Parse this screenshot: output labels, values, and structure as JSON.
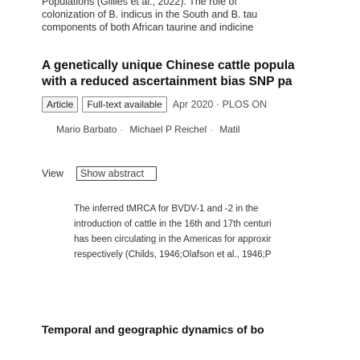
{
  "snippet": {
    "lines": [
      "Populations (Gillies et al., 2022). The role of",
      "colonization of B. indicus in the South and B. tau",
      "components of both African taurine and indicine"
    ]
  },
  "result": {
    "title_line1": "A genetically unique Chinese cattle popula",
    "title_line2": "with a reduced ascertainment bias SNP pa",
    "type_label": "Article",
    "fulltext_label": "Full-text available",
    "date": "Apr 2020 · PLOS ON",
    "authors": [
      "Mario Barbato",
      "Michael P Reichel",
      "Matil"
    ],
    "view_label": "View",
    "show_abstract_label": "Show abstract",
    "abstract_lines": [
      "The inferred tMRCA for BVDV-1 and -2 in the",
      "introduction of cattle in the 16th and 17th centuri",
      "has been circulating in the Americas for approxir",
      "respectively (Childs, 1946;Olafson et al., 1946;P"
    ]
  },
  "next_result": {
    "title": "Temporal and geographic dynamics of bo"
  }
}
